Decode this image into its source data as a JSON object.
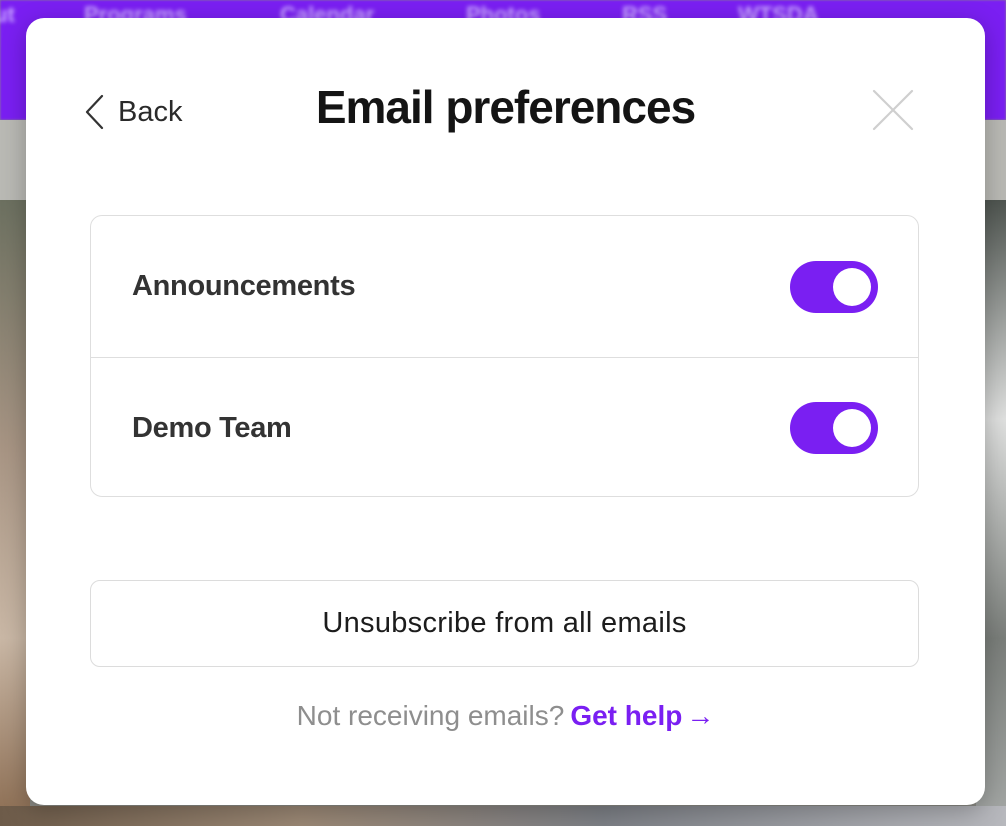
{
  "background": {
    "nav_items": [
      "ut",
      "Programs",
      "Calendar",
      "Photos",
      "RSS",
      "WTSDA"
    ],
    "nav_color": "#7a1ff2"
  },
  "modal": {
    "back_label": "Back",
    "back_icon": "chevron-left-icon",
    "title": "Email preferences",
    "close_icon": "close-icon",
    "preferences": [
      {
        "label": "Announcements",
        "enabled": true
      },
      {
        "label": "Demo Team",
        "enabled": true
      }
    ],
    "unsubscribe_label": "Unsubscribe from all emails",
    "help_text": "Not receiving emails?",
    "help_link_label": "Get help",
    "help_link_arrow": "→",
    "accent_color": "#7a1ff2"
  }
}
